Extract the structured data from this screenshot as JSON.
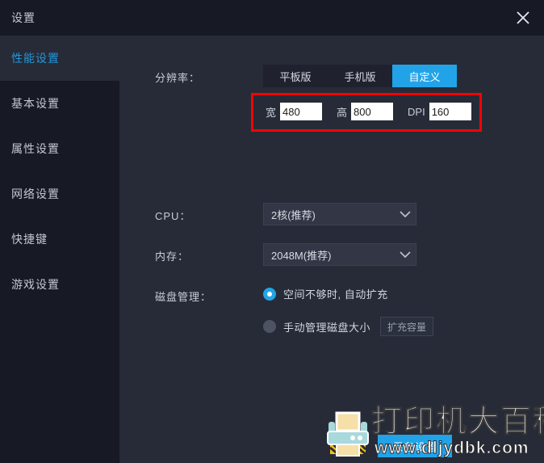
{
  "window": {
    "title": "设置",
    "close_icon": "close-icon"
  },
  "sidebar": {
    "items": [
      {
        "label": "性能设置",
        "active": true
      },
      {
        "label": "基本设置",
        "active": false
      },
      {
        "label": "属性设置",
        "active": false
      },
      {
        "label": "网络设置",
        "active": false
      },
      {
        "label": "快捷键",
        "active": false
      },
      {
        "label": "游戏设置",
        "active": false
      }
    ]
  },
  "main": {
    "resolution": {
      "label": "分辨率：",
      "tabs": [
        {
          "label": "平板版",
          "selected": false
        },
        {
          "label": "手机版",
          "selected": false
        },
        {
          "label": "自定义",
          "selected": true
        }
      ],
      "fields": [
        {
          "label": "宽",
          "value": "480"
        },
        {
          "label": "高",
          "value": "800"
        },
        {
          "label": "DPI",
          "value": "160"
        }
      ],
      "highlight_color": "#ff0000"
    },
    "cpu": {
      "label": "CPU：",
      "value": "2核(推荐)",
      "chevron_icon": "chevron-down-icon"
    },
    "memory": {
      "label": "内存：",
      "value": "2048M(推荐)",
      "chevron_icon": "chevron-down-icon"
    },
    "disk": {
      "label": "磁盘管理：",
      "option_auto": "空间不够时, 自动扩充",
      "option_manual": "手动管理磁盘大小",
      "expand_button": "扩充容量"
    },
    "save_button": "保存设置"
  },
  "watermark": {
    "brand": "打印机大百科",
    "url": "www.dljydbk.com",
    "icon": "printer-icon"
  },
  "colors": {
    "accent": "#22a3e8",
    "sidebar_bg": "#171a24",
    "panel_bg": "#272b38",
    "active_text": "#2196d9"
  }
}
